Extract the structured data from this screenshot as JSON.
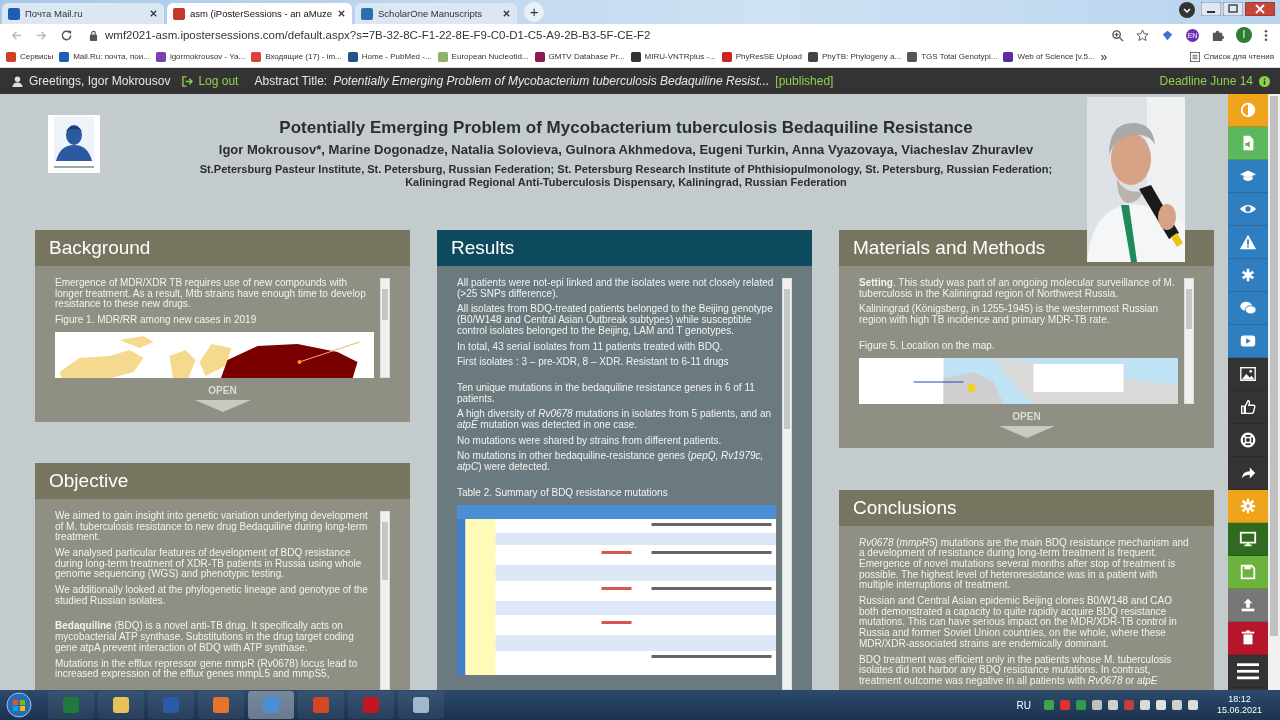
{
  "browser": {
    "tabs": [
      {
        "title": "Почта Mail.ru",
        "color": "#1d5eb5",
        "selected": false
      },
      {
        "title": "asm (iPosterSessions - an aMuze",
        "color": "#c0392b",
        "selected": true
      },
      {
        "title": "ScholarOne Manuscripts",
        "color": "#2a6fb0",
        "selected": false
      }
    ],
    "new_tab": "+",
    "url": "wmf2021-asm.ipostersessions.com/default.aspx?s=7B-32-8C-F1-22-8E-F9-C0-D1-C5-A9-2B-B3-5F-CE-F2",
    "language_badge": "EN",
    "profile": "I",
    "bookmarks": [
      {
        "label": "Сервисы",
        "color": "#d04020"
      },
      {
        "label": "Mail.Ru: почта, пои...",
        "color": "#1d5eb5"
      },
      {
        "label": "igormokrousov - Ya...",
        "color": "#7b3fb0"
      },
      {
        "label": "Входящие (17) - im...",
        "color": "#d44638"
      },
      {
        "label": "Home - PubMed -...",
        "color": "#20558a"
      },
      {
        "label": "European Nucleotid...",
        "color": "#8fb06a"
      },
      {
        "label": "GMTV Database Pr...",
        "color": "#8b1a50"
      },
      {
        "label": "MIRU-VNTRplus -...",
        "color": "#333333"
      },
      {
        "label": "PhyResSE Upload",
        "color": "#d02020"
      },
      {
        "label": "PhyTB: Phylogeny a...",
        "color": "#444444"
      },
      {
        "label": "TGS Total Genotypi...",
        "color": "#555555"
      },
      {
        "label": "Web of Science [v.5...",
        "color": "#5a2ca0"
      }
    ],
    "more": "»",
    "reading_list": "Список для чтения"
  },
  "poster_bar": {
    "greeting": "Greetings, Igor Mokrousov",
    "logout": "Log out",
    "abstract_label": "Abstract Title:",
    "abstract_title": "Potentially Emerging Problem of Mycobacterium tuberculosis Bedaquiline Resist...",
    "status": "[published]",
    "deadline": "Deadline June 14"
  },
  "poster": {
    "title": "Potentially Emerging Problem of Mycobacterium tuberculosis Bedaquiline Resistance",
    "authors": "Igor Mokrousov*, Marine Dogonadze, Natalia Solovieva, Gulnora Akhmedova, Eugeni Turkin, Anna Vyazovaya, Viacheslav Zhuravlev",
    "affiliations": "St.Petersburg Pasteur Institute, St. Petersburg, Russian Federation; St. Petersburg Research Institute of Phthisiopulmonology, St. Petersburg, Russian Federation; Kaliningrad Regional Anti-Tuberculosis Dispensary, Kaliningrad, Russian Federation",
    "columns": [
      {
        "sections": [
          {
            "heading": "Background",
            "kind": "standard",
            "scrollable": true,
            "open_label": "OPEN",
            "blocks": [
              {
                "kind": "paragraph",
                "text": "Emergence of MDR/XDR TB requires use of new compounds with longer treatment. As a result, Mtb strains have enough time to develop resistance to these new drugs.",
                "gap_before": false
              },
              {
                "kind": "caption",
                "text": "Figure 1. MDR/RR among new cases in 2019",
                "gap_before": false
              },
              {
                "kind": "picture",
                "gap_before": false
              }
            ]
          },
          {
            "heading": "Objective",
            "kind": "standard",
            "scrollable": true,
            "blocks": [
              {
                "kind": "paragraph",
                "text": "We aimed to gain insight into genetic variation underlying development of M. tuberculosis resistance to new drug Bedaquiline during long-term treatment.",
                "gap_before": false
              },
              {
                "kind": "paragraph",
                "text": "We analysed particular features of development of BDQ resistance during long-term treatment of XDR-TB patients in Russia using whole genome sequencing (WGS) and phenotypic testing.",
                "gap_before": false
              },
              {
                "kind": "paragraph",
                "text": "We additionally looked at the phylogenetic lineage and genotype of the studied Russian isolates.",
                "gap_before": false
              },
              {
                "kind": "paragraph",
                "text": "**Bedaquiline** (BDQ) is a novel anti-TB drug. It specifically acts on mycobacterial ATP synthase. Substitutions in the drug target coding gene atpA prevent interaction of BDQ with ATP synthase.",
                "gap_before": true
              },
              {
                "kind": "paragraph",
                "text": "Mutations in the efflux repressor gene mmpR (Rv0678) locus lead to increased expression of the efflux genes mmpL5 and mmpS5,",
                "gap_before": false
              }
            ]
          }
        ]
      },
      {
        "sections": [
          {
            "heading": "Results",
            "kind": "featured",
            "scrollable": true,
            "blocks": [
              {
                "kind": "paragraph",
                "text": "All patients were not-epi linked and the isolates were not closely related (>25 SNPs difference).",
                "gap_before": false
              },
              {
                "kind": "paragraph",
                "text": "All isolates from BDQ-treated patients belonged to the Beijing genotype (B0/W148 and Central Asian Outbreak subtypes) while susceptible control isolates belonged to the Beijing, LAM and T genotypes.",
                "gap_before": false
              },
              {
                "kind": "paragraph",
                "text": "In total, 43 serial isolates from 11 patients treated with BDQ.",
                "gap_before": false
              },
              {
                "kind": "paragraph",
                "text": "First isolates : 3 – pre-XDR, 8 – XDR.  Resistant to 6-11 drugs",
                "gap_before": false
              },
              {
                "kind": "paragraph",
                "text": "Ten unique mutations in the bedaquiline resistance genes in 6 of 11 patients.",
                "gap_before": true
              },
              {
                "kind": "paragraph",
                "text": "A high diversity of *Rv0678* mutations in isolates from 5 patients, and an *atpE* mutation was detected in one case.",
                "gap_before": false
              },
              {
                "kind": "paragraph",
                "text": "No mutations were shared by strains from different patients.",
                "gap_before": false
              },
              {
                "kind": "paragraph",
                "text": "No mutations in other bedaquiline-resistance genes (*pepQ, Rv1979c, atpC*) were detected.",
                "gap_before": false
              },
              {
                "kind": "caption",
                "text": "Table 2. Summary of BDQ resistance mutations",
                "gap_before": true
              },
              {
                "kind": "picture",
                "gap_before": false
              }
            ]
          }
        ]
      },
      {
        "sections": [
          {
            "heading": "Materials and Methods",
            "kind": "standard",
            "scrollable": true,
            "open_label": "OPEN",
            "blocks": [
              {
                "kind": "paragraph",
                "text": "**Setting**. This study was part of an ongoing molecular surveillance of M. tuberculosis in the Kaliningrad region of Northwest Russia.",
                "gap_before": false
              },
              {
                "kind": "paragraph",
                "text": "Kaliningrad (Königsberg, in 1255-1945) is the westernmost Russian region with high TB incidence and primary MDR-TB rate.",
                "gap_before": false
              },
              {
                "kind": "caption",
                "text": "Figure 5. Location on the map.",
                "gap_before": true
              },
              {
                "kind": "picture",
                "gap_before": false
              }
            ]
          },
          {
            "heading": "Conclusions",
            "kind": "standard",
            "scrollable": false,
            "blocks": [
              {
                "kind": "paragraph",
                "text": "*Rv0678* (*mmpR5*) mutations are the main BDQ resistance mechanism and a development of resistance during long-term treatment is frequent. Emergence of novel mutations several months after stop of treatment is possible. The highest level of heteroresistance was in a patient with multiple interruptions of treatment."
              },
              {
                "kind": "paragraph",
                "text": "Russian and Central Asian epidemic Beijing clones B0/W148 and CAO both demonstrated a capacity to quite rapidly acquire BDQ resistance mutations. This can have serious impact on the MDR/XDR-TB control in Russia and former Soviet Union countries, on the whole, where these MDR/XDR-associated strains are endemically dominant."
              },
              {
                "kind": "paragraph",
                "text": "BDQ treatment was efficient only in the patients whose M. tuberculosis isolates did not harbor any BDQ resistance mutations. In contrast, treatment outcome was negative in all patients with *Rv0678* or *atpE*"
              }
            ]
          }
        ]
      }
    ]
  },
  "toolbar": {
    "buttons": [
      {
        "color": "#f0a41c"
      },
      {
        "color": "#5cb85c"
      },
      {
        "color": "#2f7ec0"
      },
      {
        "color": "#2f7ec0"
      },
      {
        "color": "#2f7ec0"
      },
      {
        "color": "#2f7ec0"
      },
      {
        "color": "#2f7ec0"
      },
      {
        "color": "#2f7ec0"
      },
      {
        "color": "#333333"
      },
      {
        "color": "#333333"
      },
      {
        "color": "#333333"
      },
      {
        "color": "#333333"
      },
      {
        "color": "#f0a41c"
      },
      {
        "color": "#2e6b1e"
      },
      {
        "color": "#6cb33e"
      },
      {
        "color": "#777777"
      },
      {
        "color": "#b5162b"
      },
      {
        "color": "#333333"
      }
    ]
  },
  "taskbar": {
    "apps": [
      {
        "color": "#1f7a3e",
        "selected": false
      },
      {
        "color": "#e8c25a",
        "selected": false
      },
      {
        "color": "#2b5aa8",
        "selected": false
      },
      {
        "color": "#e8742a",
        "selected": false
      },
      {
        "color": "#4a90d9",
        "selected": true
      },
      {
        "color": "#d24726",
        "selected": false
      },
      {
        "color": "#c4161c",
        "selected": false
      },
      {
        "color": "#9fb8cc",
        "selected": false
      }
    ],
    "language": "RU",
    "time": "18:12",
    "date": "15.06.2021"
  }
}
